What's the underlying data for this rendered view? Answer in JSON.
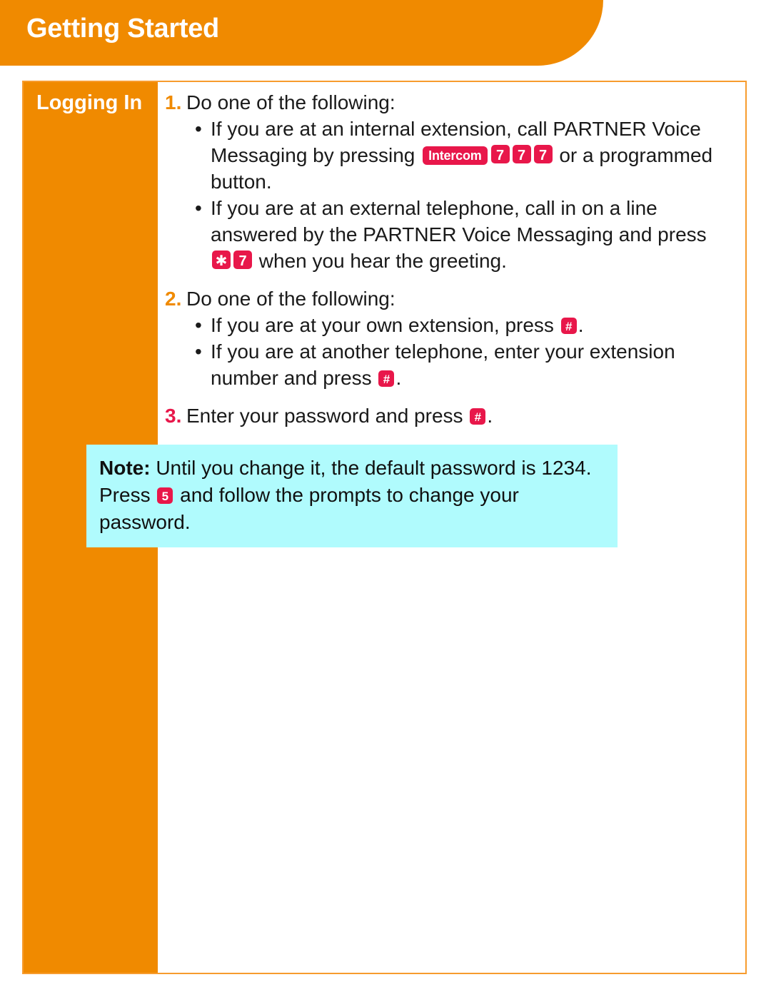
{
  "header": {
    "title": "Getting Started"
  },
  "section": {
    "title": "Logging In"
  },
  "steps": [
    {
      "number": "1.",
      "text": "Do one of the following:",
      "bullets": [
        {
          "dot": "•",
          "parts": [
            {
              "type": "text",
              "value": "If you are at an internal extension, call PARTNER Voice Messaging by pressing "
            },
            {
              "type": "key-word",
              "value": "Intercom"
            },
            {
              "type": "key-digit",
              "value": "7"
            },
            {
              "type": "key-digit",
              "value": "7"
            },
            {
              "type": "key-digit",
              "value": "7"
            },
            {
              "type": "text",
              "value": " or a programmed button."
            }
          ]
        },
        {
          "dot": "•",
          "parts": [
            {
              "type": "text",
              "value": "If you are at an external telephone, call in on a line answered by the PARTNER Voice Messaging and press "
            },
            {
              "type": "key-digit",
              "value": "✱"
            },
            {
              "type": "key-digit",
              "value": "7"
            },
            {
              "type": "text",
              "value": " when you hear the greeting."
            }
          ]
        }
      ]
    },
    {
      "number": "2.",
      "text": "Do one of the following:",
      "bullets": [
        {
          "dot": "•",
          "parts": [
            {
              "type": "text",
              "value": "If you are at your own extension, press "
            },
            {
              "type": "key-small",
              "value": "#"
            },
            {
              "type": "text",
              "value": "."
            }
          ]
        },
        {
          "dot": "•",
          "parts": [
            {
              "type": "text",
              "value": "If you are at another telephone, enter your extension number and press "
            },
            {
              "type": "key-small",
              "value": "#"
            },
            {
              "type": "text",
              "value": "."
            }
          ]
        }
      ]
    },
    {
      "number": "3.",
      "parts": [
        {
          "type": "text",
          "value": "Enter your password and press "
        },
        {
          "type": "key-small",
          "value": "#"
        },
        {
          "type": "text",
          "value": "."
        }
      ],
      "bullets": []
    }
  ],
  "note": {
    "parts": [
      {
        "type": "bold",
        "value": "Note:"
      },
      {
        "type": "text",
        "value": " Until you change it, the default password is 1234. Press "
      },
      {
        "type": "key-small",
        "value": "5"
      },
      {
        "type": "text",
        "value": " and follow the prompts to change your password."
      }
    ]
  },
  "colors": {
    "orange": "#F08A00",
    "orange_border": "#F79C2E",
    "key_red": "#E8174A",
    "note_cyan": "#B0FBFD",
    "text": "#1a1a1a"
  }
}
